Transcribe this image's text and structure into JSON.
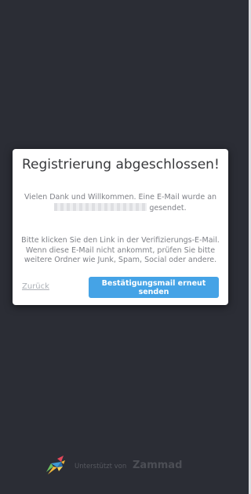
{
  "dialog": {
    "title": "Registrierung abgeschlossen!",
    "message_before_email": "Vielen Dank und Willkommen. Eine E-Mail wurde an",
    "message_after_email": "gesendet.",
    "instructions": "Bitte klicken Sie den Link in der Verifizierungs-E-Mail. Wenn diese E-Mail nicht ankommt, prüfen Sie bitte weitere Ordner wie Junk, Spam, Social oder andere.",
    "back_label": "Zurück",
    "resend_label": "Bestätigungsmail erneut senden"
  },
  "footer": {
    "powered_by": "Unterstützt von",
    "brand": "Zammad",
    "logo_icon": "zammad-bird-icon"
  },
  "colors": {
    "background": "#2b2d35",
    "card": "#ffffff",
    "button": "#45a3e6",
    "muted_text": "#7f8187"
  }
}
